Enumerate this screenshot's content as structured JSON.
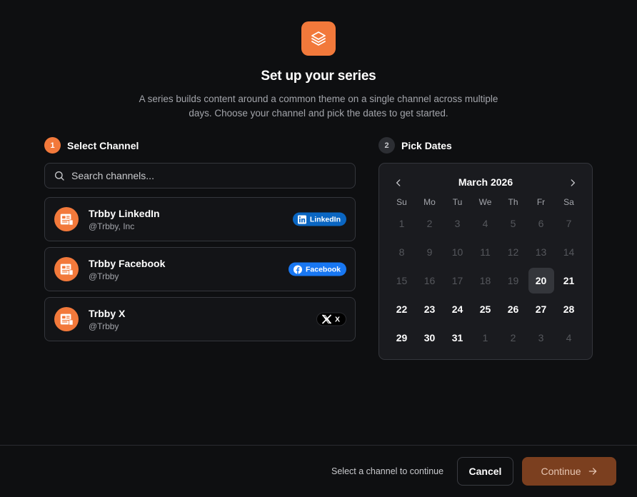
{
  "header": {
    "icon": "layers-icon",
    "title": "Set up your series",
    "subtitle": "A series builds content around a common theme on a single channel across multiple days. Choose your channel and pick the dates to get started."
  },
  "step1": {
    "number": "1",
    "label": "Select Channel"
  },
  "step2": {
    "number": "2",
    "label": "Pick Dates"
  },
  "search": {
    "placeholder": "Search channels...",
    "value": ""
  },
  "channels": [
    {
      "name": "Trbby LinkedIn",
      "handle": "@Trbby, Inc",
      "badge": "LinkedIn",
      "platform_icon": "linkedin-icon"
    },
    {
      "name": "Trbby Facebook",
      "handle": "@Trbby",
      "badge": "Facebook",
      "platform_icon": "facebook-icon"
    },
    {
      "name": "Trbby X",
      "handle": "@Trbby",
      "badge": "X",
      "platform_icon": "x-icon"
    }
  ],
  "calendar": {
    "month_label": "March 2026",
    "weekdays": [
      "Su",
      "Mo",
      "Tu",
      "We",
      "Th",
      "Fr",
      "Sa"
    ],
    "selected_today": "20",
    "weeks": [
      [
        "1",
        "2",
        "3",
        "4",
        "5",
        "6",
        "7"
      ],
      [
        "8",
        "9",
        "10",
        "11",
        "12",
        "13",
        "14"
      ],
      [
        "15",
        "16",
        "17",
        "18",
        "19",
        "20",
        "21"
      ],
      [
        "22",
        "23",
        "24",
        "25",
        "26",
        "27",
        "28"
      ],
      [
        "29",
        "30",
        "31",
        "1",
        "2",
        "3",
        "4"
      ]
    ]
  },
  "footer": {
    "hint": "Select a channel to continue",
    "cancel_label": "Cancel",
    "continue_label": "Continue"
  },
  "colors": {
    "accent": "#f2793b",
    "background": "#0e0f11",
    "continue_disabled": "#7b3f1f",
    "linkedin": "#0a66c2",
    "facebook": "#1877f2"
  }
}
